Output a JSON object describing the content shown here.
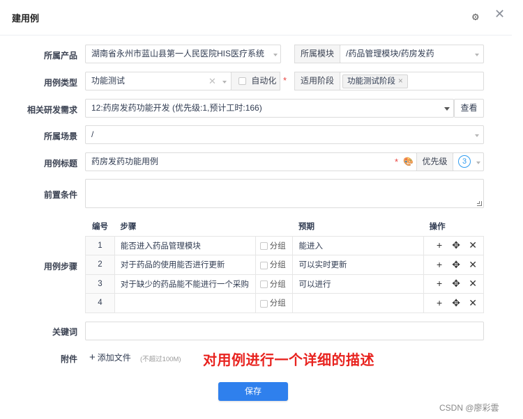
{
  "dialog": {
    "title": "建用例",
    "settings_icon": "gear-icon",
    "close_icon": "close-icon"
  },
  "form": {
    "product": {
      "label": "所属产品",
      "value": "湖南省永州市蓝山县第一人民医院HIS医疗系统"
    },
    "module": {
      "label": "所属模块",
      "value": "/药品管理模块/药房发药"
    },
    "case_type": {
      "label": "用例类型",
      "value": "功能测试"
    },
    "automation": {
      "label": "自动化",
      "checked": false
    },
    "stage": {
      "label": "适用阶段",
      "tag": "功能测试阶段"
    },
    "requirement": {
      "label": "相关研发需求",
      "value": "12:药房发药功能开发 (优先级:1,预计工时:166)",
      "view_button": "查看"
    },
    "scene": {
      "label": "所属场景",
      "value": "/"
    },
    "title": {
      "label": "用例标题",
      "value": "药房发药功能用例"
    },
    "priority": {
      "label": "优先级",
      "value": "3"
    },
    "precondition": {
      "label": "前置条件",
      "value": ""
    },
    "steps": {
      "label": "用例步骤",
      "headers": {
        "num": "编号",
        "step": "步骤",
        "expected": "预期",
        "ops": "操作"
      },
      "group_label": "分组",
      "rows": [
        {
          "num": "1",
          "step": "能否进入药品管理模块",
          "expected": "能进入"
        },
        {
          "num": "2",
          "step": "对于药品的使用能否进行更新",
          "expected": "可以实时更新"
        },
        {
          "num": "3",
          "step": "对于缺少的药品能不能进行一个采购",
          "expected": "可以进行"
        },
        {
          "num": "4",
          "step": "",
          "expected": ""
        }
      ]
    },
    "keywords": {
      "label": "关键词",
      "value": ""
    },
    "attachment": {
      "label": "附件",
      "add_label": "添加文件",
      "hint": "(不超过100M)"
    }
  },
  "annotation": "对用例进行一个详细的描述",
  "save_button": "保存",
  "watermark": "CSDN @廖彩雲",
  "colors": {
    "primary": "#2f80ed",
    "required": "#e9433f",
    "annotation": "#e8231f",
    "priority": "#2f9cf0"
  }
}
